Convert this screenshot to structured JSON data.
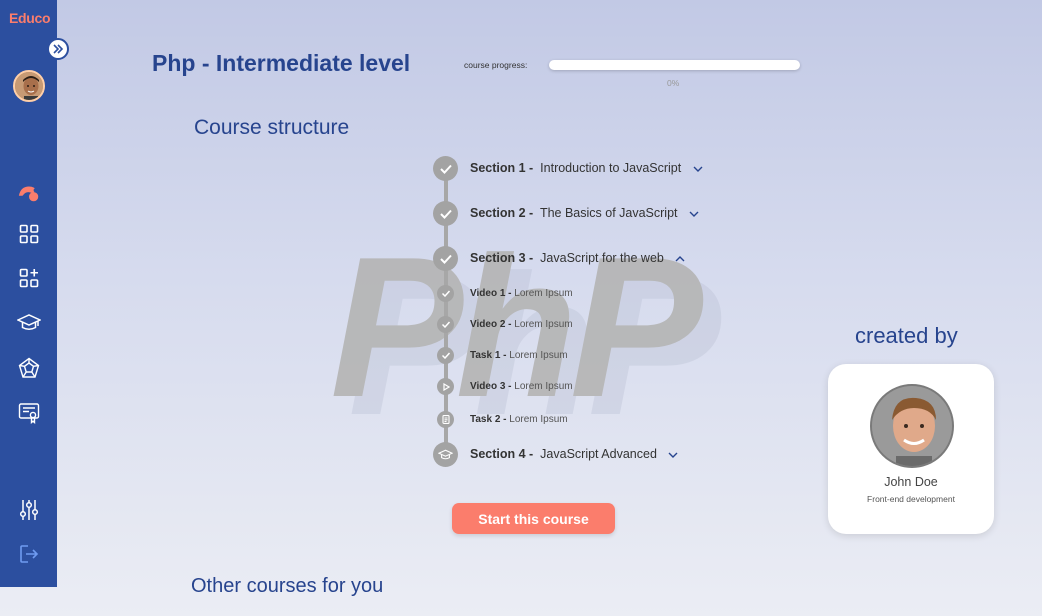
{
  "app": {
    "logo": "Educo"
  },
  "sidebar": {
    "items": [
      {
        "icon": "course-logo-icon"
      },
      {
        "icon": "dashboard-grid-icon"
      },
      {
        "icon": "add-grid-icon"
      },
      {
        "icon": "graduation-cap-icon"
      },
      {
        "icon": "pentagon-web-icon"
      },
      {
        "icon": "certificate-icon"
      },
      {
        "icon": "settings-sliders-icon"
      },
      {
        "icon": "logout-icon"
      }
    ],
    "accent_color": "#fb7d6c",
    "background_color": "#2c4f9f"
  },
  "header": {
    "title": "Php - Intermediate level",
    "progress_label": "course progress:",
    "progress_value": 0,
    "progress_text": "0%"
  },
  "structure": {
    "heading": "Course structure",
    "watermark": "PhP",
    "sections": [
      {
        "number": "Section 1 -",
        "title": "Introduction to JavaScript",
        "status": "completed",
        "expanded": false
      },
      {
        "number": "Section 2 -",
        "title": "The Basics of JavaScript",
        "status": "completed",
        "expanded": false
      },
      {
        "number": "Section 3 -",
        "title": "JavaScript for the web",
        "status": "completed",
        "expanded": true,
        "items": [
          {
            "label": "Video 1 -",
            "title": "Lorem Ipsum",
            "status": "completed",
            "icon": "check-icon"
          },
          {
            "label": "Video 2 -",
            "title": "Lorem Ipsum",
            "status": "completed",
            "icon": "check-icon"
          },
          {
            "label": "Task 1 -",
            "title": "Lorem Ipsum",
            "status": "completed",
            "icon": "check-icon"
          },
          {
            "label": "Video 3 -",
            "title": "Lorem Ipsum",
            "status": "pending",
            "icon": "play-icon"
          },
          {
            "label": "Task 2 -",
            "title": "Lorem Ipsum",
            "status": "pending",
            "icon": "document-icon"
          }
        ]
      },
      {
        "number": "Section 4 -",
        "title": "JavaScript Advanced",
        "status": "pending",
        "expanded": false,
        "icon": "graduation-cap-icon"
      }
    ]
  },
  "actions": {
    "start_label": "Start this course"
  },
  "author": {
    "heading": "created by",
    "name": "John Doe",
    "role": "Front-end development"
  },
  "other": {
    "heading": "Other courses for you"
  }
}
